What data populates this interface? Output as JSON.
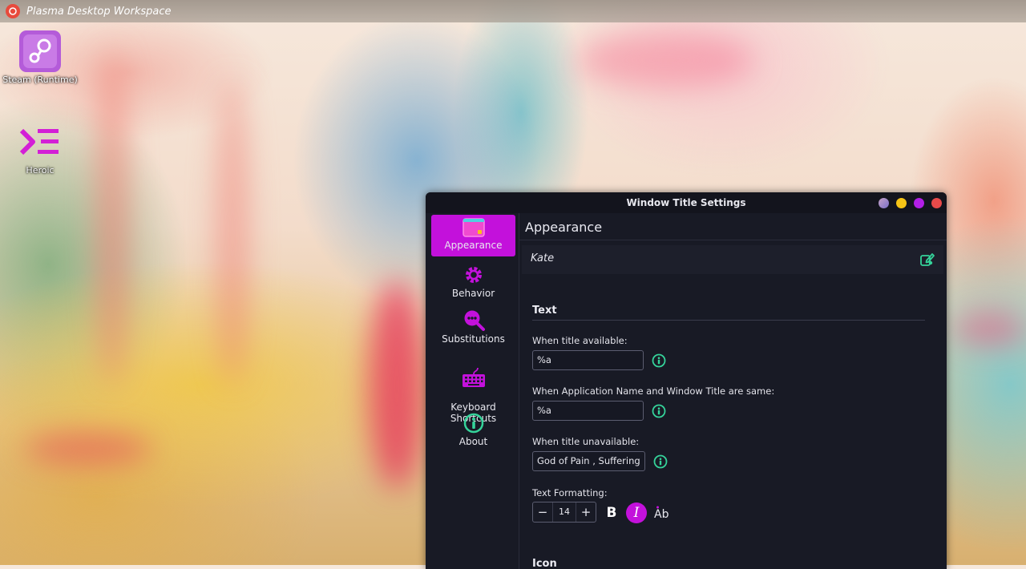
{
  "desktop": {
    "title": "Plasma Desktop Workspace",
    "icons": [
      {
        "label": "Steam (Runtime)",
        "icon": "steam-icon"
      },
      {
        "label": "Heroic",
        "icon": "heroic-icon"
      }
    ]
  },
  "window": {
    "title": "Window Title Settings",
    "buttons": [
      "keep-above",
      "minimize",
      "maximize",
      "close"
    ],
    "colors": {
      "active": "#c311db",
      "accent_green": "#35d39a",
      "close": "#e84a4a",
      "minimize": "#f6c416",
      "maximize": "#b21fe6",
      "keep_above": "#9b8bc9"
    }
  },
  "sidebar": {
    "items": [
      {
        "label": "Appearance",
        "icon": "appearance-icon",
        "active": true
      },
      {
        "label": "Behavior",
        "icon": "gear-icon"
      },
      {
        "label": "Substitutions",
        "icon": "search-dots-icon"
      },
      {
        "label": "Keyboard\nShortcuts",
        "icon": "keyboard-icon"
      },
      {
        "label": "About",
        "icon": "info-icon"
      }
    ]
  },
  "main": {
    "page_title": "Appearance",
    "preview_app": "Kate",
    "text_section": "Text",
    "fields": [
      {
        "label": "When title available:",
        "value": "%a"
      },
      {
        "label": "When Application Name and Window Title are same:",
        "value": "%a"
      },
      {
        "label": "When title unavailable:",
        "value": "God of Pain , Suffering 🔥"
      }
    ],
    "formatting_label": "Text Formatting:",
    "font_size": "14",
    "icon_section": "Icon"
  }
}
